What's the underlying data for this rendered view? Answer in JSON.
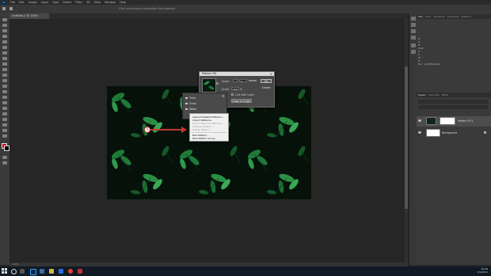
{
  "menubar": {
    "app_logo": "Ps",
    "items": [
      "File",
      "Edit",
      "Image",
      "Layer",
      "Type",
      "Select",
      "Filter",
      "3D",
      "View",
      "Window",
      "Help"
    ]
  },
  "options_bar": {
    "hint": "Click and drag to reposition the patterns"
  },
  "document_tab": {
    "label": "Untitled-1 @ 100% (RGB/8)"
  },
  "status_bar": {
    "zoom": "100%"
  },
  "pattern_fill_dialog": {
    "title": "Pattern Fill",
    "angle_label": "Angle:",
    "angle_value": "0",
    "scale_label": "Scale:",
    "scale_value": "100",
    "scale_unit": "%",
    "link_with_layer": "Link with Layer",
    "snap_to_origin": "Snap to Origin",
    "ok": "OK",
    "cancel": "Cancel"
  },
  "preset_picker": {
    "folders": [
      "Trees",
      "Grass",
      "Water"
    ]
  },
  "flyout_menu": {
    "items": [
      {
        "label": "Append Default Patterns...",
        "enabled": true
      },
      {
        "label": "Import Patterns...",
        "enabled": true
      },
      {
        "label": "Export Selected Patterns...",
        "enabled": false
      },
      {
        "label": "Rename Pattern...",
        "enabled": false
      },
      {
        "label": "Delete Pattern...",
        "enabled": false
      },
      {
        "label": "New Pattern...",
        "enabled": true
      },
      {
        "label": "New Pattern Group...",
        "enabled": true
      }
    ]
  },
  "annotation": {
    "step": "1"
  },
  "right_panels": {
    "top_tabs": [
      "Info",
      "Color",
      "Swatches",
      "Gradients",
      "Patterns"
    ],
    "info_lines": [
      "R:",
      "G:",
      "B:",
      "8-bit",
      "X:",
      "Y:",
      "W:",
      "H:",
      "Doc: 1.34M/0 bytes"
    ],
    "layers_tabs": [
      "Layers",
      "Channels",
      "Paths"
    ],
    "layers": [
      {
        "name": "Pattern Fill 1"
      },
      {
        "name": "Background"
      }
    ]
  },
  "taskbar": {
    "time": "19:06",
    "date": "3/1/2021"
  },
  "colors": {
    "foreground": "#c8102e",
    "background": "#000000",
    "annotation": "#c0392b"
  }
}
